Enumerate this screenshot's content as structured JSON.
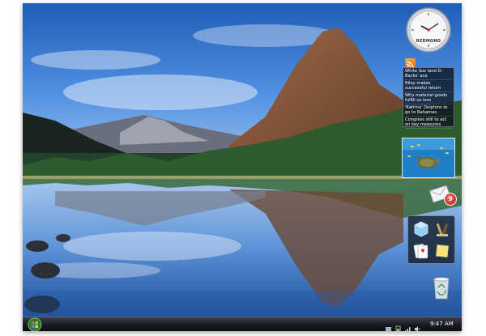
{
  "desktop": {
    "wallpaper": "mountain-lake-reflection",
    "taskbar_color": "#15191e",
    "start_button_icon": "windows-start-orb-icon"
  },
  "sidebar": {
    "clock": {
      "label": "REDMOND",
      "time_shown": "9:47",
      "icon": "analog-clock-icon"
    },
    "feed_headlines": {
      "icon": "rss-feed-icon",
      "items": [
        "White Sox land D-Backs' ace",
        "Riley makes successful return",
        "Why material goods fulfill us less",
        "'Katrina' Dolphins to go to Bahamas",
        "Congress still to act on key measures"
      ]
    },
    "slideshow": {
      "subject": "sea-turtle-underwater-photo"
    },
    "mail": {
      "icon": "envelope-icon",
      "count": "9"
    },
    "games": {
      "tiles": [
        "glass-cube-icon",
        "chess-pieces-icon",
        "playing-cards-icon",
        "sticky-note-icon"
      ]
    }
  },
  "recycle_bin": {
    "icon": "recycle-bin-icon"
  },
  "tray": {
    "time": "9:47 AM",
    "icons": [
      "network-icon",
      "battery-icon",
      "signal-icon",
      "volume-icon"
    ]
  }
}
